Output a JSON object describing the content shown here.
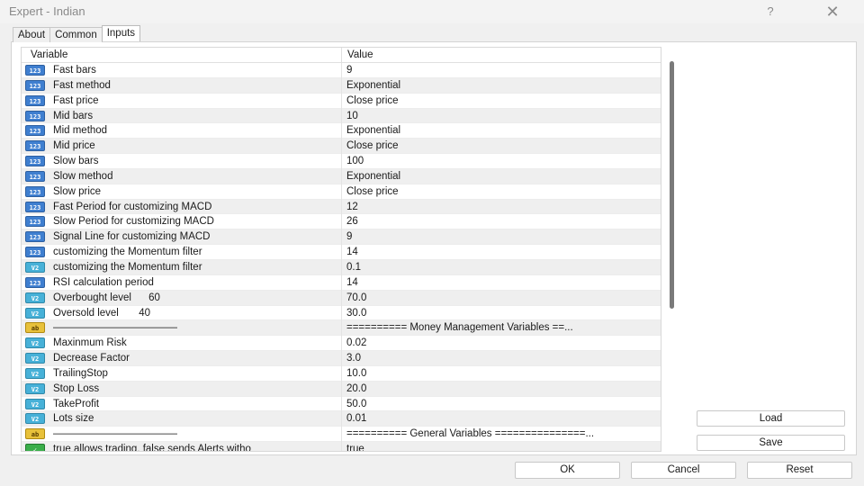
{
  "window": {
    "title": "Expert - Indian",
    "help_label": "?",
    "close_label": "✕"
  },
  "tabs": [
    {
      "label": "About",
      "active": false
    },
    {
      "label": "Common",
      "active": false
    },
    {
      "label": "Inputs",
      "active": true
    }
  ],
  "grid": {
    "columns": {
      "variable": "Variable",
      "value": "Value"
    },
    "rows": [
      {
        "type": "int",
        "icon": "123",
        "name": "Fast bars",
        "value": "9"
      },
      {
        "type": "int",
        "icon": "123",
        "name": "Fast method",
        "value": "Exponential"
      },
      {
        "type": "int",
        "icon": "123",
        "name": "Fast price",
        "value": "Close price"
      },
      {
        "type": "int",
        "icon": "123",
        "name": "Mid bars",
        "value": "10"
      },
      {
        "type": "int",
        "icon": "123",
        "name": "Mid method",
        "value": "Exponential"
      },
      {
        "type": "int",
        "icon": "123",
        "name": "Mid price",
        "value": "Close price"
      },
      {
        "type": "int",
        "icon": "123",
        "name": "Slow bars",
        "value": "100"
      },
      {
        "type": "int",
        "icon": "123",
        "name": "Slow method",
        "value": "Exponential"
      },
      {
        "type": "int",
        "icon": "123",
        "name": "Slow price",
        "value": "Close price"
      },
      {
        "type": "int",
        "icon": "123",
        "name": "Fast Period for customizing MACD",
        "value": "12"
      },
      {
        "type": "int",
        "icon": "123",
        "name": "Slow Period for customizing MACD",
        "value": "26"
      },
      {
        "type": "int",
        "icon": "123",
        "name": "Signal Line for customizing MACD",
        "value": "9"
      },
      {
        "type": "int",
        "icon": "123",
        "name": "customizing the Momentum filter",
        "value": "14"
      },
      {
        "type": "dbl",
        "icon": "V2",
        "name": "customizing the Momentum filter",
        "value": "0.1"
      },
      {
        "type": "int",
        "icon": "123",
        "name": "RSI calculation period",
        "value": "14"
      },
      {
        "type": "dbl",
        "icon": "V2",
        "name": "Overbought level      60",
        "value": "70.0"
      },
      {
        "type": "dbl",
        "icon": "V2",
        "name": "Oversold level       40",
        "value": "30.0"
      },
      {
        "type": "str",
        "icon": "ab",
        "name": "————————————",
        "value": "========== Money Management Variables ==..."
      },
      {
        "type": "dbl",
        "icon": "V2",
        "name": "Maxinmum Risk",
        "value": "0.02"
      },
      {
        "type": "dbl",
        "icon": "V2",
        "name": "Decrease Factor",
        "value": "3.0"
      },
      {
        "type": "dbl",
        "icon": "V2",
        "name": "TrailingStop",
        "value": "10.0"
      },
      {
        "type": "dbl",
        "icon": "V2",
        "name": "Stop Loss",
        "value": "20.0"
      },
      {
        "type": "dbl",
        "icon": "V2",
        "name": "TakeProfit",
        "value": "50.0"
      },
      {
        "type": "dbl",
        "icon": "V2",
        "name": "Lots size",
        "value": "0.01"
      },
      {
        "type": "str",
        "icon": "ab",
        "name": "————————————",
        "value": "========== General Variables ===============..."
      },
      {
        "type": "bool",
        "icon": "✓",
        "name": "true allows trading, false sends Alerts witho",
        "value": "true"
      }
    ]
  },
  "side_buttons": {
    "load": "Load",
    "save": "Save"
  },
  "bottom_buttons": {
    "ok": "OK",
    "cancel": "Cancel",
    "reset": "Reset"
  }
}
